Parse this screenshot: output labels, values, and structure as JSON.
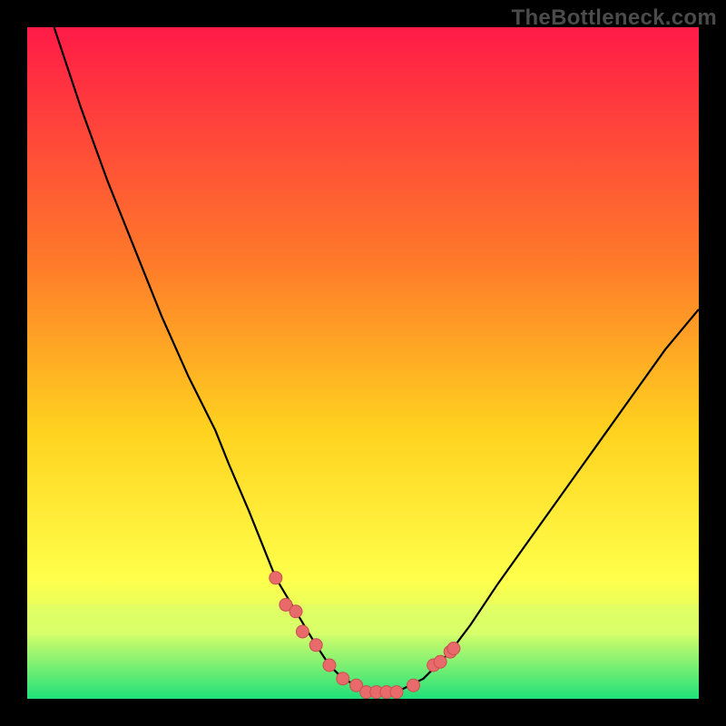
{
  "watermark": "TheBottleneck.com",
  "colors": {
    "frame_bg": "#000000",
    "gradient_top": "#ff1b47",
    "gradient_mid1": "#ff7a2a",
    "gradient_mid2": "#ffd21f",
    "gradient_mid3": "#ffff4a",
    "gradient_bottom_band": "#d8ff6a",
    "gradient_green": "#20e07a",
    "curve_stroke": "#000000",
    "marker_fill": "#e86a6a",
    "marker_stroke": "#c94f4f"
  },
  "chart_data": {
    "type": "line",
    "title": "",
    "xlabel": "",
    "ylabel": "",
    "xlim": [
      0,
      100
    ],
    "ylim": [
      0,
      100
    ],
    "grid": false,
    "legend": false,
    "series": [
      {
        "name": "bottleneck-curve",
        "x": [
          4,
          8,
          12,
          16,
          20,
          24,
          28,
          30,
          33,
          35,
          37,
          40,
          43,
          45,
          47,
          49,
          51,
          53,
          55,
          57,
          59,
          61,
          63,
          66,
          70,
          75,
          80,
          85,
          90,
          95,
          100
        ],
        "y": [
          100,
          88,
          77,
          67,
          57,
          48,
          40,
          35,
          28,
          23,
          18,
          13,
          8,
          5,
          3,
          2,
          1,
          1,
          1,
          2,
          3,
          5,
          7,
          11,
          17,
          24,
          31,
          38,
          45,
          52,
          58
        ]
      }
    ],
    "markers": {
      "name": "highlighted-points",
      "x": [
        37,
        38.5,
        40,
        41,
        43,
        45,
        47,
        49,
        50.5,
        52,
        53.5,
        55,
        57.5,
        60.5,
        61.5,
        63,
        63.5
      ],
      "y": [
        18,
        14,
        13,
        10,
        8,
        5,
        3,
        2,
        1,
        1,
        1,
        1,
        2,
        5,
        5.5,
        7,
        7.5
      ]
    }
  }
}
